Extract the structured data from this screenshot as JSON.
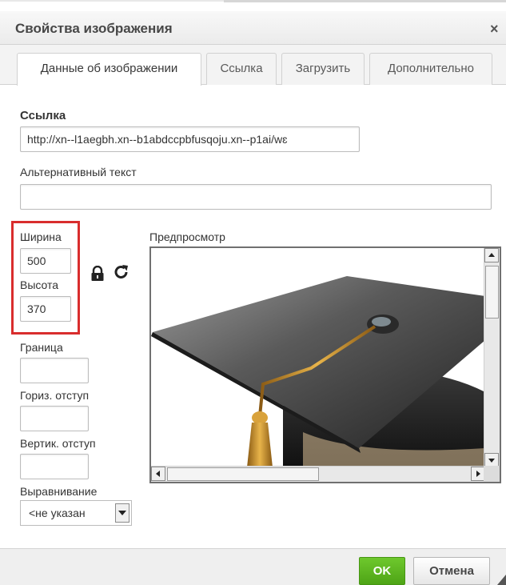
{
  "dialog": {
    "title": "Свойства изображения",
    "close_symbol": "×"
  },
  "tabs": [
    {
      "label": "Данные об изображении",
      "active": true
    },
    {
      "label": "Ссылка",
      "active": false
    },
    {
      "label": "Загрузить",
      "active": false
    },
    {
      "label": "Дополнительно",
      "active": false
    }
  ],
  "fields": {
    "url_label": "Ссылка",
    "url_value": "http://xn--l1aegbh.xn--b1abdccpbfusqoju.xn--p1ai/wɛ",
    "alt_label": "Альтернативный текст",
    "alt_value": "",
    "width_label": "Ширина",
    "width_value": "500",
    "height_label": "Высота",
    "height_value": "370",
    "border_label": "Граница",
    "border_value": "",
    "hspace_label": "Гориз. отступ",
    "hspace_value": "",
    "vspace_label": "Вертик. отступ",
    "vspace_value": "",
    "align_label": "Выравнивание",
    "align_value": "<не указан"
  },
  "preview": {
    "label": "Предпросмотр",
    "image_subject": "graduation-cap"
  },
  "icons": {
    "lock": "lock-icon",
    "reset": "reset-size-icon"
  },
  "buttons": {
    "ok": "OK",
    "cancel": "Отмена"
  },
  "colors": {
    "ok_green": "#5cb41f",
    "highlight_red": "#d92d2d"
  }
}
